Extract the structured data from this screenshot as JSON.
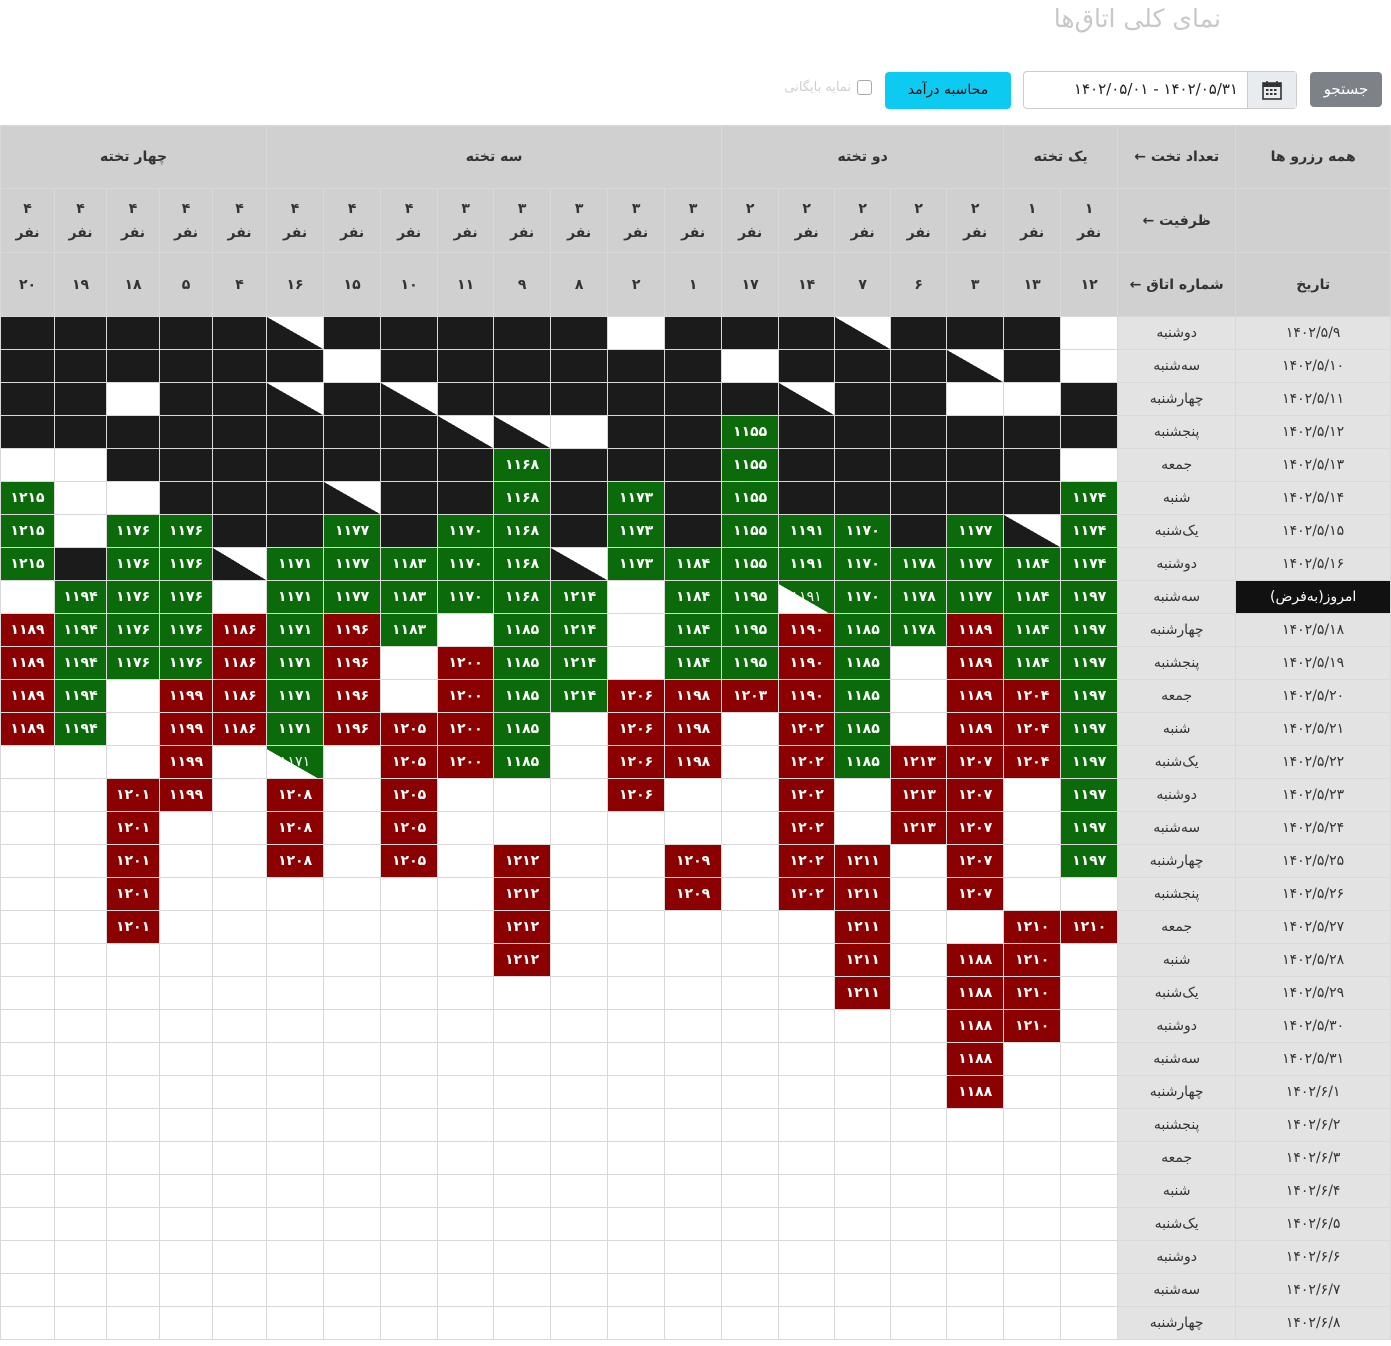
{
  "header": {
    "title": "نمای کلی اتاق‌ها"
  },
  "toolbar": {
    "search_label": "جستجو",
    "date_range": "۱۴۰۲/۰۵/۰۱ - ۱۴۰۲/۰۵/۳۱",
    "calc_label": "محاسبه درآمد",
    "archive_label": "نمایه بایگانی"
  },
  "table": {
    "corner": "همه رزرو ها",
    "bed_label": "تعداد تخت ←",
    "cap_label": "ظرفیت ←",
    "room_label": "شماره اتاق ←",
    "date_label": "تاریخ",
    "groups": [
      {
        "label": "یک تخته",
        "span": 2
      },
      {
        "label": "دو تخته",
        "span": 5
      },
      {
        "label": "سه تخته",
        "span": 8
      },
      {
        "label": "چهار تخته",
        "span": 5
      }
    ],
    "rooms": [
      {
        "room": "۱۲",
        "cap": "۱",
        "unit": "نفر"
      },
      {
        "room": "۱۳",
        "cap": "۱",
        "unit": "نفر"
      },
      {
        "room": "۳",
        "cap": "۲",
        "unit": "نفر"
      },
      {
        "room": "۶",
        "cap": "۲",
        "unit": "نفر"
      },
      {
        "room": "۷",
        "cap": "۲",
        "unit": "نفر"
      },
      {
        "room": "۱۴",
        "cap": "۲",
        "unit": "نفر"
      },
      {
        "room": "۱۷",
        "cap": "۲",
        "unit": "نفر"
      },
      {
        "room": "۱",
        "cap": "۳",
        "unit": "نفر"
      },
      {
        "room": "۲",
        "cap": "۳",
        "unit": "نفر"
      },
      {
        "room": "۸",
        "cap": "۳",
        "unit": "نفر"
      },
      {
        "room": "۹",
        "cap": "۳",
        "unit": "نفر"
      },
      {
        "room": "۱۱",
        "cap": "۳",
        "unit": "نفر"
      },
      {
        "room": "۱۰",
        "cap": "۴",
        "unit": "نفر"
      },
      {
        "room": "۱۵",
        "cap": "۴",
        "unit": "نفر"
      },
      {
        "room": "۱۶",
        "cap": "۴",
        "unit": "نفر"
      },
      {
        "room": "۴",
        "cap": "۴",
        "unit": "نفر"
      },
      {
        "room": "۵",
        "cap": "۴",
        "unit": "نفر"
      },
      {
        "room": "۱۸",
        "cap": "۴",
        "unit": "نفر"
      },
      {
        "room": "۱۹",
        "cap": "۴",
        "unit": "نفر"
      },
      {
        "room": "۲۰",
        "cap": "۴",
        "unit": "نفر"
      }
    ],
    "today_label": "امروز(به‌فرض)",
    "rows": [
      {
        "date": "۱۴۰۲/۵/۹",
        "day": "دوشنبه",
        "cells": [
          "w",
          "b",
          "b",
          "b",
          "x",
          "b",
          "b",
          "b",
          "w",
          "b",
          "b",
          "b",
          "b",
          "b",
          "x",
          "b",
          "b",
          "b",
          "b",
          "b"
        ]
      },
      {
        "date": "۱۴۰۲/۵/۱۰",
        "day": "سه‌شنبه",
        "cells": [
          "w",
          "b",
          "y",
          "b",
          "b",
          "b",
          "w",
          "b",
          "b",
          "b",
          "b",
          "b",
          "b",
          "w",
          "b",
          "b",
          "b",
          "b",
          "b",
          "b"
        ]
      },
      {
        "date": "۱۴۰۲/۵/۱۱",
        "day": "چهارشنبه",
        "cells": [
          "b",
          "w",
          "w",
          "b",
          "b",
          "y",
          "b",
          "b",
          "b",
          "b",
          "b",
          "b",
          "y",
          "b",
          "y",
          "b",
          "b",
          "w",
          "b",
          "b"
        ]
      },
      {
        "date": "۱۴۰۲/۵/۱۲",
        "day": "پنجشنبه",
        "cells": [
          "b",
          "b",
          "b",
          "b",
          "b",
          "b",
          "g:۱۱۵۵",
          "b",
          "b",
          "w",
          "y",
          "y",
          "b",
          "b",
          "b",
          "b",
          "b",
          "b",
          "b",
          "b"
        ]
      },
      {
        "date": "۱۴۰۲/۵/۱۳",
        "day": "جمعه",
        "cells": [
          "w",
          "b",
          "b",
          "b",
          "b",
          "b",
          "g:۱۱۵۵",
          "b",
          "b",
          "b",
          "g:۱۱۶۸",
          "b",
          "b",
          "b",
          "b",
          "b",
          "b",
          "b",
          "w",
          "w"
        ]
      },
      {
        "date": "۱۴۰۲/۵/۱۴",
        "day": "شنبه",
        "cells": [
          "g:۱۱۷۴",
          "b",
          "b",
          "b",
          "b",
          "b",
          "g:۱۱۵۵",
          "b",
          "g:۱۱۷۳",
          "b",
          "g:۱۱۶۸",
          "b",
          "b",
          "y",
          "b",
          "b",
          "b",
          "w",
          "w",
          "g:۱۲۱۵"
        ]
      },
      {
        "date": "۱۴۰۲/۵/۱۵",
        "day": "یک‌شنبه",
        "cells": [
          "g:۱۱۷۴",
          "y",
          "g:۱۱۷۷",
          "b",
          "g:۱۱۷۰",
          "g:۱۱۹۱",
          "g:۱۱۵۵",
          "b",
          "g:۱۱۷۳",
          "b",
          "g:۱۱۶۸",
          "g:۱۱۷۰",
          "b",
          "g:۱۱۷۷",
          "b",
          "b",
          "g:۱۱۷۶",
          "g:۱۱۷۶",
          "w",
          "g:۱۲۱۵"
        ]
      },
      {
        "date": "۱۴۰۲/۵/۱۶",
        "day": "دوشنبه",
        "cells": [
          "g:۱۱۷۴",
          "g:۱۱۸۴",
          "g:۱۱۷۷",
          "g:۱۱۷۸",
          "g:۱۱۷۰",
          "g:۱۱۹۱",
          "g:۱۱۵۵",
          "g:۱۱۸۴",
          "g:۱۱۷۳",
          "y",
          "g:۱۱۶۸",
          "g:۱۱۷۰",
          "g:۱۱۸۳",
          "g:۱۱۷۷",
          "g:۱۱۷۱",
          "y",
          "g:۱۱۷۶",
          "g:۱۱۷۶",
          "b",
          "g:۱۲۱۵"
        ]
      },
      {
        "date": "امروز",
        "day": "سه‌شنبه",
        "today": true,
        "cells": [
          "g:۱۱۹۷",
          "g:۱۱۸۴",
          "g:۱۱۷۷",
          "g:۱۱۷۸",
          "g:۱۱۷۰",
          "gx:۱۱۹۱",
          "g:۱۱۹۵",
          "g:۱۱۸۴",
          "w",
          "g:۱۲۱۴",
          "g:۱۱۶۸",
          "g:۱۱۷۰",
          "g:۱۱۸۳",
          "g:۱۱۷۷",
          "g:۱۱۷۱",
          "w",
          "g:۱۱۷۶",
          "g:۱۱۷۶",
          "g:۱۱۹۴",
          "w"
        ]
      },
      {
        "date": "۱۴۰۲/۵/۱۸",
        "day": "چهارشنبه",
        "cells": [
          "g:۱۱۹۷",
          "g:۱۱۸۴",
          "r:۱۱۸۹",
          "g:۱۱۷۸",
          "g:۱۱۸۵",
          "r:۱۱۹۰",
          "g:۱۱۹۵",
          "g:۱۱۸۴",
          "w",
          "g:۱۲۱۴",
          "g:۱۱۸۵",
          "w",
          "g:۱۱۸۳",
          "r:۱۱۹۶",
          "g:۱۱۷۱",
          "r:۱۱۸۶",
          "g:۱۱۷۶",
          "g:۱۱۷۶",
          "g:۱۱۹۴",
          "r:۱۱۸۹"
        ]
      },
      {
        "date": "۱۴۰۲/۵/۱۹",
        "day": "پنجشنبه",
        "cells": [
          "g:۱۱۹۷",
          "g:۱۱۸۴",
          "r:۱۱۸۹",
          "w",
          "g:۱۱۸۵",
          "r:۱۱۹۰",
          "g:۱۱۹۵",
          "g:۱۱۸۴",
          "w",
          "g:۱۲۱۴",
          "g:۱۱۸۵",
          "r:۱۲۰۰",
          "w",
          "r:۱۱۹۶",
          "g:۱۱۷۱",
          "r:۱۱۸۶",
          "g:۱۱۷۶",
          "g:۱۱۷۶",
          "g:۱۱۹۴",
          "r:۱۱۸۹"
        ]
      },
      {
        "date": "۱۴۰۲/۵/۲۰",
        "day": "جمعه",
        "cells": [
          "g:۱۱۹۷",
          "r:۱۲۰۴",
          "r:۱۱۸۹",
          "w",
          "g:۱۱۸۵",
          "r:۱۱۹۰",
          "r:۱۲۰۳",
          "r:۱۱۹۸",
          "r:۱۲۰۶",
          "g:۱۲۱۴",
          "g:۱۱۸۵",
          "r:۱۲۰۰",
          "w",
          "r:۱۱۹۶",
          "g:۱۱۷۱",
          "r:۱۱۸۶",
          "r:۱۱۹۹",
          "w",
          "g:۱۱۹۴",
          "r:۱۱۸۹"
        ]
      },
      {
        "date": "۱۴۰۲/۵/۲۱",
        "day": "شنبه",
        "cells": [
          "g:۱۱۹۷",
          "r:۱۲۰۴",
          "r:۱۱۸۹",
          "w",
          "g:۱۱۸۵",
          "r:۱۲۰۲",
          "w",
          "r:۱۱۹۸",
          "r:۱۲۰۶",
          "w",
          "g:۱۱۸۵",
          "r:۱۲۰۰",
          "r:۱۲۰۵",
          "r:۱۱۹۶",
          "g:۱۱۷۱",
          "r:۱۱۸۶",
          "r:۱۱۹۹",
          "w",
          "g:۱۱۹۴",
          "r:۱۱۸۹"
        ]
      },
      {
        "date": "۱۴۰۲/۵/۲۲",
        "day": "یک‌شنبه",
        "cells": [
          "g:۱۱۹۷",
          "r:۱۲۰۴",
          "r:۱۲۰۷",
          "r:۱۲۱۳",
          "g:۱۱۸۵",
          "r:۱۲۰۲",
          "w",
          "r:۱۱۹۸",
          "r:۱۲۰۶",
          "w",
          "g:۱۱۸۵",
          "r:۱۲۰۰",
          "r:۱۲۰۵",
          "w",
          "gx:۱۱۷۱",
          "w",
          "r:۱۱۹۹",
          "w",
          "w",
          "w"
        ]
      },
      {
        "date": "۱۴۰۲/۵/۲۳",
        "day": "دوشنبه",
        "cells": [
          "g:۱۱۹۷",
          "w",
          "r:۱۲۰۷",
          "r:۱۲۱۳",
          "w",
          "r:۱۲۰۲",
          "w",
          "w",
          "r:۱۲۰۶",
          "w",
          "w",
          "w",
          "r:۱۲۰۵",
          "w",
          "r:۱۲۰۸",
          "w",
          "r:۱۱۹۹",
          "r:۱۲۰۱",
          "w",
          "w"
        ]
      },
      {
        "date": "۱۴۰۲/۵/۲۴",
        "day": "سه‌شنبه",
        "cells": [
          "g:۱۱۹۷",
          "w",
          "r:۱۲۰۷",
          "r:۱۲۱۳",
          "w",
          "r:۱۲۰۲",
          "w",
          "w",
          "w",
          "w",
          "w",
          "w",
          "r:۱۲۰۵",
          "w",
          "r:۱۲۰۸",
          "w",
          "w",
          "r:۱۲۰۱",
          "w",
          "w"
        ]
      },
      {
        "date": "۱۴۰۲/۵/۲۵",
        "day": "چهارشنبه",
        "cells": [
          "g:۱۱۹۷",
          "w",
          "r:۱۲۰۷",
          "w",
          "r:۱۲۱۱",
          "r:۱۲۰۲",
          "w",
          "r:۱۲۰۹",
          "w",
          "w",
          "r:۱۲۱۲",
          "w",
          "r:۱۲۰۵",
          "w",
          "r:۱۲۰۸",
          "w",
          "w",
          "r:۱۲۰۱",
          "w",
          "w"
        ]
      },
      {
        "date": "۱۴۰۲/۵/۲۶",
        "day": "پنجشنبه",
        "cells": [
          "w",
          "w",
          "r:۱۲۰۷",
          "w",
          "r:۱۲۱۱",
          "r:۱۲۰۲",
          "w",
          "r:۱۲۰۹",
          "w",
          "w",
          "r:۱۲۱۲",
          "w",
          "w",
          "w",
          "w",
          "w",
          "w",
          "r:۱۲۰۱",
          "w",
          "w"
        ]
      },
      {
        "date": "۱۴۰۲/۵/۲۷",
        "day": "جمعه",
        "cells": [
          "r:۱۲۱۰",
          "r:۱۲۱۰",
          "w",
          "w",
          "r:۱۲۱۱",
          "w",
          "w",
          "w",
          "w",
          "w",
          "r:۱۲۱۲",
          "w",
          "w",
          "w",
          "w",
          "w",
          "w",
          "r:۱۲۰۱",
          "w",
          "w"
        ]
      },
      {
        "date": "۱۴۰۲/۵/۲۸",
        "day": "شنبه",
        "cells": [
          "w",
          "r:۱۲۱۰",
          "r:۱۱۸۸",
          "w",
          "r:۱۲۱۱",
          "w",
          "w",
          "w",
          "w",
          "w",
          "r:۱۲۱۲",
          "w",
          "w",
          "w",
          "w",
          "w",
          "w",
          "w",
          "w",
          "w"
        ]
      },
      {
        "date": "۱۴۰۲/۵/۲۹",
        "day": "یک‌شنبه",
        "cells": [
          "w",
          "r:۱۲۱۰",
          "r:۱۱۸۸",
          "w",
          "r:۱۲۱۱",
          "w",
          "w",
          "w",
          "w",
          "w",
          "w",
          "w",
          "w",
          "w",
          "w",
          "w",
          "w",
          "w",
          "w",
          "w"
        ]
      },
      {
        "date": "۱۴۰۲/۵/۳۰",
        "day": "دوشنبه",
        "cells": [
          "w",
          "r:۱۲۱۰",
          "r:۱۱۸۸",
          "w",
          "w",
          "w",
          "w",
          "w",
          "w",
          "w",
          "w",
          "w",
          "w",
          "w",
          "w",
          "w",
          "w",
          "w",
          "w",
          "w"
        ]
      },
      {
        "date": "۱۴۰۲/۵/۳۱",
        "day": "سه‌شنبه",
        "cells": [
          "w",
          "w",
          "r:۱۱۸۸",
          "w",
          "w",
          "w",
          "w",
          "w",
          "w",
          "w",
          "w",
          "w",
          "w",
          "w",
          "w",
          "w",
          "w",
          "w",
          "w",
          "w"
        ]
      },
      {
        "date": "۱۴۰۲/۶/۱",
        "day": "چهارشنبه",
        "cells": [
          "w",
          "w",
          "r:۱۱۸۸",
          "w",
          "w",
          "w",
          "w",
          "w",
          "w",
          "w",
          "w",
          "w",
          "w",
          "w",
          "w",
          "w",
          "w",
          "w",
          "w",
          "w"
        ]
      },
      {
        "date": "۱۴۰۲/۶/۲",
        "day": "پنجشنبه",
        "cells": [
          "w",
          "w",
          "w",
          "w",
          "w",
          "w",
          "w",
          "w",
          "w",
          "w",
          "w",
          "w",
          "w",
          "w",
          "w",
          "w",
          "w",
          "w",
          "w",
          "w"
        ]
      },
      {
        "date": "۱۴۰۲/۶/۳",
        "day": "جمعه",
        "cells": [
          "w",
          "w",
          "w",
          "w",
          "w",
          "w",
          "w",
          "w",
          "w",
          "w",
          "w",
          "w",
          "w",
          "w",
          "w",
          "w",
          "w",
          "w",
          "w",
          "w"
        ]
      },
      {
        "date": "۱۴۰۲/۶/۴",
        "day": "شنبه",
        "cells": [
          "w",
          "w",
          "w",
          "w",
          "w",
          "w",
          "w",
          "w",
          "w",
          "w",
          "w",
          "w",
          "w",
          "w",
          "w",
          "w",
          "w",
          "w",
          "w",
          "w"
        ]
      },
      {
        "date": "۱۴۰۲/۶/۵",
        "day": "یک‌شنبه",
        "cells": [
          "w",
          "w",
          "w",
          "w",
          "w",
          "w",
          "w",
          "w",
          "w",
          "w",
          "w",
          "w",
          "w",
          "w",
          "w",
          "w",
          "w",
          "w",
          "w",
          "w"
        ]
      },
      {
        "date": "۱۴۰۲/۶/۶",
        "day": "دوشنبه",
        "cells": [
          "w",
          "w",
          "w",
          "w",
          "w",
          "w",
          "w",
          "w",
          "w",
          "w",
          "w",
          "w",
          "w",
          "w",
          "w",
          "w",
          "w",
          "w",
          "w",
          "w"
        ]
      },
      {
        "date": "۱۴۰۲/۶/۷",
        "day": "سه‌شنبه",
        "cells": [
          "w",
          "w",
          "w",
          "w",
          "w",
          "w",
          "w",
          "w",
          "w",
          "w",
          "w",
          "w",
          "w",
          "w",
          "w",
          "w",
          "w",
          "w",
          "w",
          "w"
        ]
      },
      {
        "date": "۱۴۰۲/۶/۸",
        "day": "چهارشنبه",
        "cells": [
          "w",
          "w",
          "w",
          "w",
          "w",
          "w",
          "w",
          "w",
          "w",
          "w",
          "w",
          "w",
          "w",
          "w",
          "w",
          "w",
          "w",
          "w",
          "w",
          "w"
        ]
      }
    ]
  },
  "colors": {
    "booked_green": "#0b6b0b",
    "booked_red": "#8b0000",
    "blocked": "#1b1b1b",
    "info_button": "#0dcaf0"
  }
}
